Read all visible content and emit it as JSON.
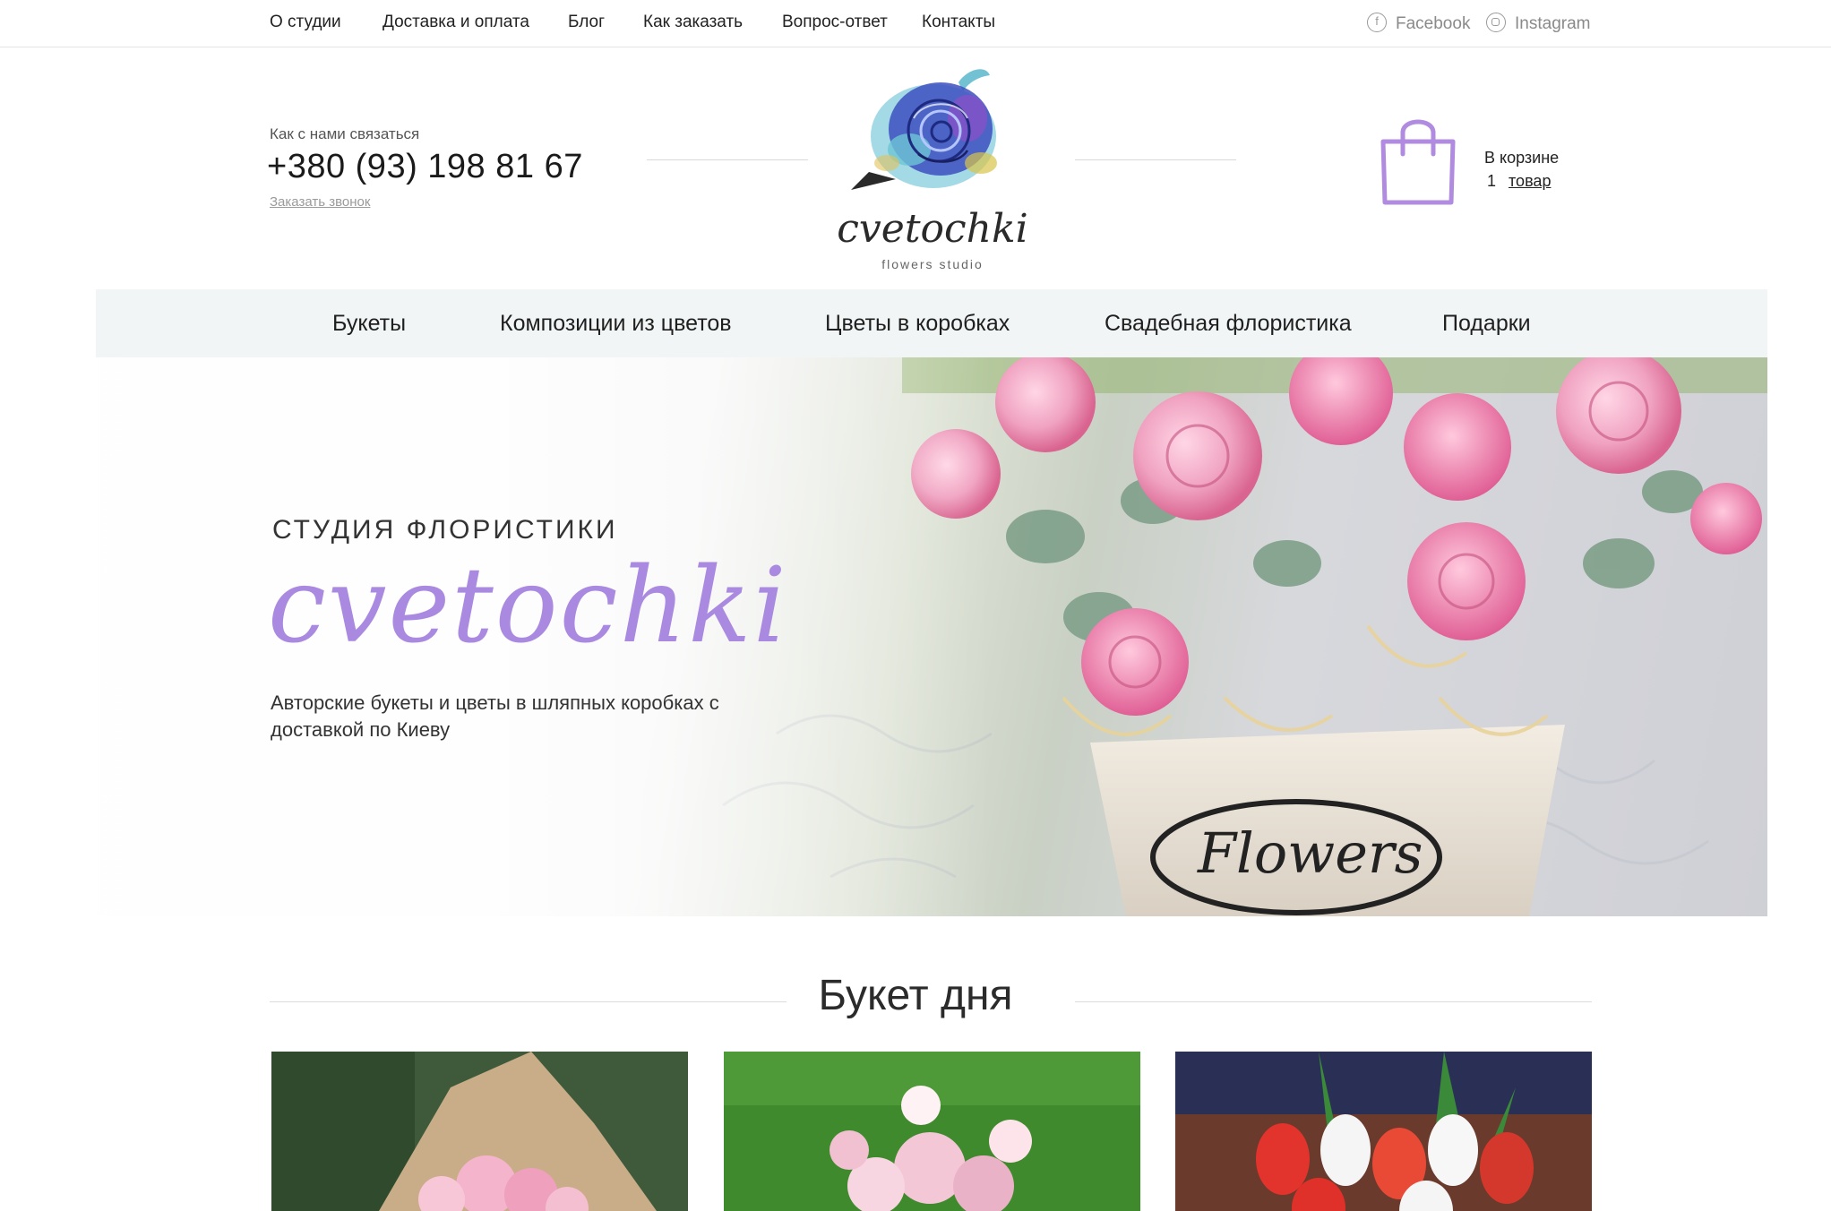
{
  "topnav": {
    "items": [
      "О студии",
      "Доставка и оплата",
      "Блог",
      "Как заказать",
      "Вопрос-ответ",
      "Контакты"
    ],
    "social": [
      {
        "label": "Facebook",
        "icon": "facebook-icon"
      },
      {
        "label": "Instagram",
        "icon": "instagram-icon"
      }
    ]
  },
  "header": {
    "contact_label": "Как с нами связаться",
    "phone": "+380 (93) 198 81 67",
    "call_link": "Заказать звонок",
    "logo_word": "cvetochki",
    "logo_sub": "flowers studio",
    "cart_title": "В корзине",
    "cart_count": "1",
    "cart_unit": "товар",
    "cart_icon": "shopping-bag-icon"
  },
  "mainnav": {
    "items": [
      "Букеты",
      "Композиции из цветов",
      "Цветы в коробках",
      "Свадебная флористика",
      "Подарки"
    ]
  },
  "hero": {
    "kicker": "СТУДИЯ ФЛОРИСТИКИ",
    "brand": "cvetochki",
    "description": "Авторские букеты и цветы в шляпных коробках с доставкой по Киеву",
    "box_label": "Flowers"
  },
  "section": {
    "title": "Букет дня"
  },
  "colors": {
    "accent": "#a98ae0",
    "nav_bg": "#f1f5f5",
    "text": "#1f1f1f",
    "muted": "#8a8a8a"
  }
}
